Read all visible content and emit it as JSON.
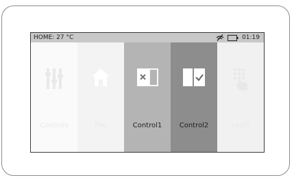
{
  "status": {
    "home_temp": "HOME: 27 °C",
    "time": "01:19",
    "signal_icon": "no-signal-icon",
    "battery_icon": "battery-icon"
  },
  "tiles": [
    {
      "label": "Controls",
      "icon": "sliders-icon",
      "state": "faded"
    },
    {
      "label": "Fire",
      "icon": "house-icon",
      "state": "faded"
    },
    {
      "label": "Control1",
      "icon": "door-x-icon",
      "state": "active"
    },
    {
      "label": "Control2",
      "icon": "door-check-icon",
      "state": "active"
    },
    {
      "label": "Login",
      "icon": "touch-keypad-icon",
      "state": "faded"
    }
  ],
  "colors": {
    "status_bar": "#c8c8c8",
    "tile_control1": "#b4b4b4",
    "tile_control2": "#8d8d8d",
    "faded_tile": "#f4f4f4"
  }
}
